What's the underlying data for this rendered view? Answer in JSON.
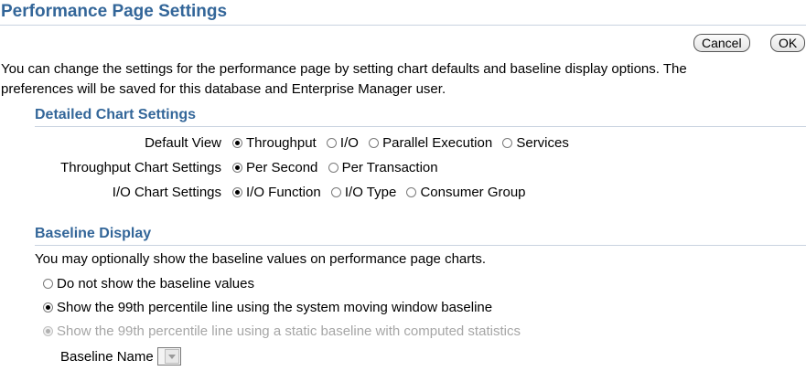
{
  "page": {
    "title": "Performance Page Settings",
    "cancel_label": "Cancel",
    "ok_label": "OK",
    "intro_line1": "You can change the settings for the performance page by setting chart defaults and baseline display options. The",
    "intro_line2": "preferences will be saved for this database and Enterprise Manager user."
  },
  "detailed": {
    "header": "Detailed Chart Settings",
    "default_view": {
      "label": "Default View",
      "options": [
        {
          "label": "Throughput",
          "checked": true
        },
        {
          "label": "I/O",
          "checked": false
        },
        {
          "label": "Parallel Execution",
          "checked": false
        },
        {
          "label": "Services",
          "checked": false
        }
      ]
    },
    "throughput": {
      "label": "Throughput Chart Settings",
      "options": [
        {
          "label": "Per Second",
          "checked": true
        },
        {
          "label": "Per Transaction",
          "checked": false
        }
      ]
    },
    "io": {
      "label": "I/O Chart Settings",
      "options": [
        {
          "label": "I/O Function",
          "checked": true
        },
        {
          "label": "I/O Type",
          "checked": false
        },
        {
          "label": "Consumer Group",
          "checked": false
        }
      ]
    }
  },
  "baseline": {
    "header": "Baseline Display",
    "description": "You may optionally show the baseline values on performance page charts.",
    "options": [
      {
        "label": "Do not show the baseline values",
        "checked": false,
        "disabled": false
      },
      {
        "label": "Show the 99th percentile line using the system moving window baseline",
        "checked": true,
        "disabled": false
      },
      {
        "label": "Show the 99th percentile line using a static baseline with computed statistics",
        "checked": true,
        "disabled": true
      }
    ],
    "name_label": "Baseline Name",
    "name_value": ""
  },
  "colors": {
    "header_blue": "#336699",
    "header_rule": "#c9d3e0",
    "disabled_text": "#a6a6a6"
  }
}
